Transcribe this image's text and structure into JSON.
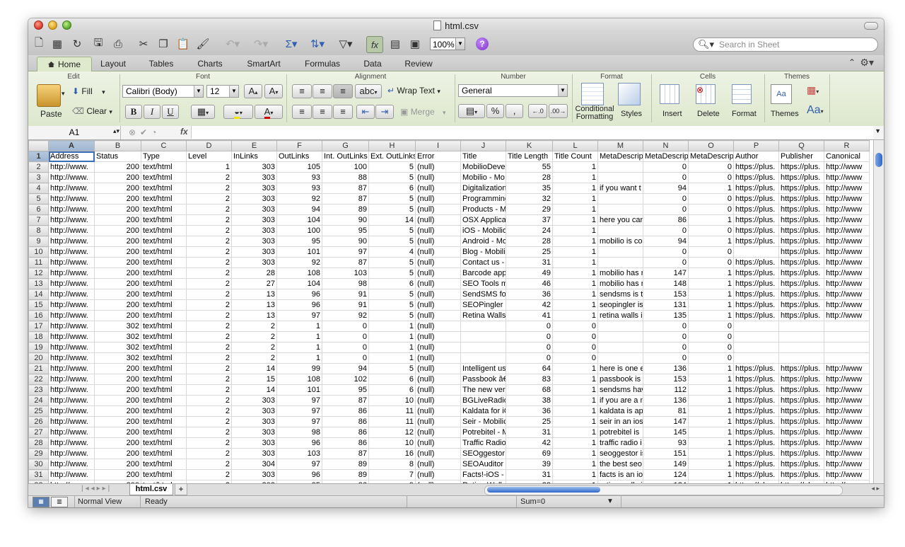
{
  "window": {
    "title": "html.csv"
  },
  "toolbar": {
    "zoom": "100%",
    "search_placeholder": "Search in Sheet"
  },
  "tabs": [
    "Home",
    "Layout",
    "Tables",
    "Charts",
    "SmartArt",
    "Formulas",
    "Data",
    "Review"
  ],
  "ribbon": {
    "groups": {
      "edit": "Edit",
      "font": "Font",
      "alignment": "Alignment",
      "number": "Number",
      "format": "Format",
      "cells": "Cells",
      "themes": "Themes"
    },
    "paste": "Paste",
    "fill": "Fill",
    "clear": "Clear",
    "font_name": "Calibri (Body)",
    "font_size": "12",
    "wrap_text": "Wrap Text",
    "merge": "Merge",
    "number_format": "General",
    "conditional_formatting_1": "Conditional",
    "conditional_formatting_2": "Formatting",
    "styles": "Styles",
    "insert": "Insert",
    "delete": "Delete",
    "format_btn": "Format",
    "themes_btn": "Themes"
  },
  "formula_bar": {
    "name_box": "A1",
    "fx": "fx"
  },
  "grid": {
    "columns": [
      "A",
      "B",
      "C",
      "D",
      "E",
      "F",
      "G",
      "H",
      "I",
      "J",
      "K",
      "L",
      "M",
      "N",
      "O",
      "P",
      "Q",
      "R"
    ],
    "rows": [
      [
        "1",
        "Address",
        "Status",
        "Type",
        "Level",
        "InLinks",
        "OutLinks",
        "Int. OutLinks",
        "Ext. OutLinks",
        "Error",
        "Title",
        "Title Length",
        "Title Count",
        "MetaDescrip",
        "MetaDescrip",
        "MetaDescrip",
        "Author",
        "Publisher",
        "Canonical"
      ],
      [
        "2",
        "http://www.",
        "200",
        "text/html",
        "1",
        "303",
        "105",
        "100",
        "5",
        "(null)",
        "MobilioDeve",
        "55",
        "1",
        "",
        "0",
        "0",
        "https://plus.",
        "https://plus.",
        "http://www"
      ],
      [
        "3",
        "http://www.",
        "200",
        "text/html",
        "2",
        "303",
        "93",
        "88",
        "5",
        "(null)",
        "Mobilio - Mo",
        "28",
        "1",
        "",
        "0",
        "0",
        "https://plus.",
        "https://plus.",
        "http://www"
      ],
      [
        "4",
        "http://www.",
        "200",
        "text/html",
        "2",
        "303",
        "93",
        "87",
        "6",
        "(null)",
        "Digitalization",
        "35",
        "1",
        "if you want t",
        "94",
        "1",
        "https://plus.",
        "https://plus.",
        "http://www"
      ],
      [
        "5",
        "http://www.",
        "200",
        "text/html",
        "2",
        "303",
        "92",
        "87",
        "5",
        "(null)",
        "Programming",
        "32",
        "1",
        "",
        "0",
        "0",
        "https://plus.",
        "https://plus.",
        "http://www"
      ],
      [
        "6",
        "http://www.",
        "200",
        "text/html",
        "2",
        "303",
        "94",
        "89",
        "5",
        "(null)",
        "Products - M",
        "29",
        "1",
        "",
        "0",
        "0",
        "https://plus.",
        "https://plus.",
        "http://www"
      ],
      [
        "7",
        "http://www.",
        "200",
        "text/html",
        "2",
        "303",
        "104",
        "90",
        "14",
        "(null)",
        "OSX Applicat",
        "37",
        "1",
        "here you can",
        "86",
        "1",
        "https://plus.",
        "https://plus.",
        "http://www"
      ],
      [
        "8",
        "http://www.",
        "200",
        "text/html",
        "2",
        "303",
        "100",
        "95",
        "5",
        "(null)",
        "iOS - Mobilio",
        "24",
        "1",
        "",
        "0",
        "0",
        "https://plus.",
        "https://plus.",
        "http://www"
      ],
      [
        "9",
        "http://www.",
        "200",
        "text/html",
        "2",
        "303",
        "95",
        "90",
        "5",
        "(null)",
        "Android - Mo",
        "28",
        "1",
        "mobilio is co",
        "94",
        "1",
        "https://plus.",
        "https://plus.",
        "http://www"
      ],
      [
        "10",
        "http://www.",
        "200",
        "text/html",
        "2",
        "303",
        "101",
        "97",
        "4",
        "(null)",
        "Blog - Mobili",
        "25",
        "1",
        "",
        "0",
        "0",
        "",
        "https://plus.",
        "http://www"
      ],
      [
        "11",
        "http://www.",
        "200",
        "text/html",
        "2",
        "303",
        "92",
        "87",
        "5",
        "(null)",
        "Contact us -",
        "31",
        "1",
        "",
        "0",
        "0",
        "https://plus.",
        "https://plus.",
        "http://www"
      ],
      [
        "12",
        "http://www.",
        "200",
        "text/html",
        "2",
        "28",
        "108",
        "103",
        "5",
        "(null)",
        "Barcode app",
        "49",
        "1",
        "mobilio has r",
        "147",
        "1",
        "https://plus.",
        "https://plus.",
        "http://www"
      ],
      [
        "13",
        "http://www.",
        "200",
        "text/html",
        "2",
        "27",
        "104",
        "98",
        "6",
        "(null)",
        "SEO Tools m",
        "46",
        "1",
        "mobilio has r",
        "148",
        "1",
        "https://plus.",
        "https://plus.",
        "http://www"
      ],
      [
        "14",
        "http://www.",
        "200",
        "text/html",
        "2",
        "13",
        "96",
        "91",
        "5",
        "(null)",
        "SendSMS for",
        "36",
        "1",
        "sendsms is th",
        "153",
        "1",
        "https://plus.",
        "https://plus.",
        "http://www"
      ],
      [
        "15",
        "http://www.",
        "200",
        "text/html",
        "2",
        "13",
        "96",
        "91",
        "5",
        "(null)",
        "SEOPingler -",
        "42",
        "1",
        "seopingler is",
        "131",
        "1",
        "https://plus.",
        "https://plus.",
        "http://www"
      ],
      [
        "16",
        "http://www.",
        "200",
        "text/html",
        "2",
        "13",
        "97",
        "92",
        "5",
        "(null)",
        "Retina Walls",
        "41",
        "1",
        "retina walls i",
        "135",
        "1",
        "https://plus.",
        "https://plus.",
        "http://www"
      ],
      [
        "17",
        "http://www.",
        "302",
        "text/html",
        "2",
        "2",
        "1",
        "0",
        "1",
        "(null)",
        "",
        "0",
        "0",
        "",
        "0",
        "0",
        "",
        "",
        ""
      ],
      [
        "18",
        "http://www.",
        "302",
        "text/html",
        "2",
        "2",
        "1",
        "0",
        "1",
        "(null)",
        "",
        "0",
        "0",
        "",
        "0",
        "0",
        "",
        "",
        ""
      ],
      [
        "19",
        "http://www.",
        "302",
        "text/html",
        "2",
        "2",
        "1",
        "0",
        "1",
        "(null)",
        "",
        "0",
        "0",
        "",
        "0",
        "0",
        "",
        "",
        ""
      ],
      [
        "20",
        "http://www.",
        "302",
        "text/html",
        "2",
        "2",
        "1",
        "0",
        "1",
        "(null)",
        "",
        "0",
        "0",
        "",
        "0",
        "0",
        "",
        "",
        ""
      ],
      [
        "21",
        "http://www.",
        "200",
        "text/html",
        "2",
        "14",
        "99",
        "94",
        "5",
        "(null)",
        "Intelligent us",
        "64",
        "1",
        "here is one e",
        "136",
        "1",
        "https://plus.",
        "https://plus.",
        "http://www"
      ],
      [
        "22",
        "http://www.",
        "200",
        "text/html",
        "2",
        "15",
        "108",
        "102",
        "6",
        "(null)",
        "Passbook â€˜",
        "83",
        "1",
        "passbook is a",
        "153",
        "1",
        "https://plus.",
        "https://plus.",
        "http://www"
      ],
      [
        "23",
        "http://www.",
        "200",
        "text/html",
        "2",
        "14",
        "101",
        "95",
        "6",
        "(null)",
        "The new vers",
        "68",
        "1",
        "sendsms hav",
        "112",
        "1",
        "https://plus.",
        "https://plus.",
        "http://www"
      ],
      [
        "24",
        "http://www.",
        "200",
        "text/html",
        "2",
        "303",
        "97",
        "87",
        "10",
        "(null)",
        "BGLiveRadio",
        "38",
        "1",
        "if you are a n",
        "136",
        "1",
        "https://plus.",
        "https://plus.",
        "http://www"
      ],
      [
        "25",
        "http://www.",
        "200",
        "text/html",
        "2",
        "303",
        "97",
        "86",
        "11",
        "(null)",
        "Kaldata for iC",
        "36",
        "1",
        "kaldata is ap",
        "81",
        "1",
        "https://plus.",
        "https://plus.",
        "http://www"
      ],
      [
        "26",
        "http://www.",
        "200",
        "text/html",
        "2",
        "303",
        "97",
        "86",
        "11",
        "(null)",
        "Seir - Mobilic",
        "25",
        "1",
        "seir in an ios",
        "147",
        "1",
        "https://plus.",
        "https://plus.",
        "http://www"
      ],
      [
        "27",
        "http://www.",
        "200",
        "text/html",
        "2",
        "303",
        "98",
        "86",
        "12",
        "(null)",
        "Potrebitel - M",
        "31",
        "1",
        "potrebitel is",
        "145",
        "1",
        "https://plus.",
        "https://plus.",
        "http://www"
      ],
      [
        "28",
        "http://www.",
        "200",
        "text/html",
        "2",
        "303",
        "96",
        "86",
        "10",
        "(null)",
        "Traffic Radio",
        "42",
        "1",
        "traffic radio i",
        "93",
        "1",
        "https://plus.",
        "https://plus.",
        "http://www"
      ],
      [
        "29",
        "http://www.",
        "200",
        "text/html",
        "2",
        "303",
        "103",
        "87",
        "16",
        "(null)",
        "SEOggestor -",
        "69",
        "1",
        "seoggestor is",
        "151",
        "1",
        "https://plus.",
        "https://plus.",
        "http://www"
      ],
      [
        "30",
        "http://www.",
        "200",
        "text/html",
        "2",
        "304",
        "97",
        "89",
        "8",
        "(null)",
        "SEOAuditor f",
        "39",
        "1",
        "the best seo",
        "149",
        "1",
        "https://plus.",
        "https://plus.",
        "http://www"
      ],
      [
        "31",
        "http://www.",
        "200",
        "text/html",
        "2",
        "303",
        "96",
        "89",
        "7",
        "(null)",
        "Facts!-iOS - M",
        "31",
        "1",
        "facts is an ios",
        "124",
        "1",
        "https://plus.",
        "https://plus.",
        "http://www"
      ],
      [
        "32",
        "http://www.",
        "200",
        "text/html",
        "2",
        "303",
        "95",
        "86",
        "9",
        "(null)",
        "Retina Walls",
        "33",
        "1",
        "retina walls i",
        "134",
        "1",
        "https://plus.",
        "https://plus.",
        "http://www"
      ]
    ]
  },
  "sheet_tab": "html.csv",
  "status": {
    "view": "Normal View",
    "state": "Ready",
    "sum": "Sum=0"
  }
}
